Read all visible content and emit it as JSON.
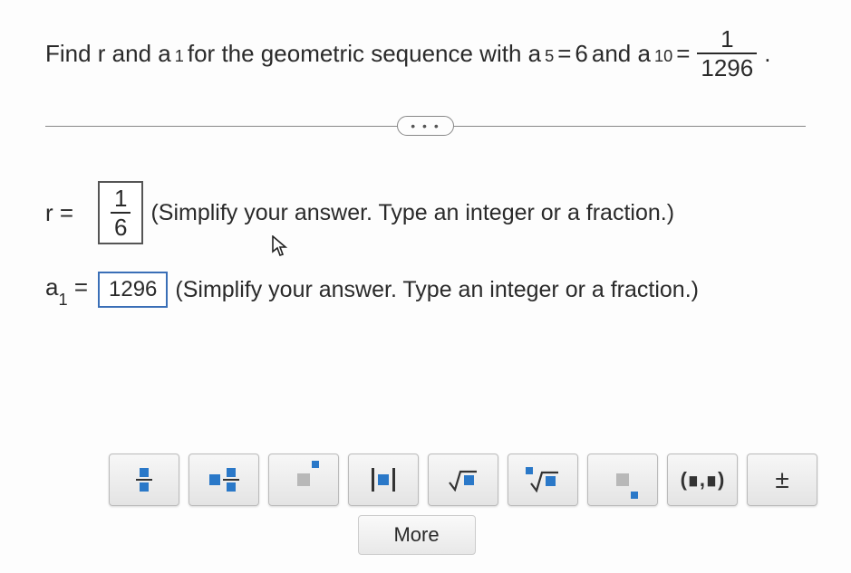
{
  "question": {
    "prefix": "Find r and a",
    "sub1": "1",
    "mid1": " for the geometric sequence with a",
    "sub5": "5",
    "eq1": " = ",
    "a5_value": "6",
    "and": " and a",
    "sub10": "10",
    "eq2": " = ",
    "a10_frac": {
      "num": "1",
      "den": "1296"
    },
    "period": "."
  },
  "divider": {
    "dots": "• • •"
  },
  "answers": {
    "r": {
      "label": "r =",
      "value": {
        "num": "1",
        "den": "6"
      },
      "hint": "(Simplify your answer. Type an integer or a fraction.)"
    },
    "a1": {
      "label_pre": "a",
      "label_sub": "1",
      "label_post": " =",
      "value": "1296",
      "hint": "(Simplify your answer. Type an integer or a fraction.)"
    }
  },
  "palette": {
    "buttons": [
      {
        "name": "fraction",
        "label": "fraction"
      },
      {
        "name": "mixed-number",
        "label": "mixed number"
      },
      {
        "name": "exponent",
        "label": "exponent"
      },
      {
        "name": "absolute-value",
        "label": "absolute value"
      },
      {
        "name": "square-root",
        "label": "square root"
      },
      {
        "name": "nth-root",
        "label": "nth root"
      },
      {
        "name": "subscript",
        "label": "subscript"
      },
      {
        "name": "ordered-pair",
        "label": "(∎,∎)"
      },
      {
        "name": "plus-minus",
        "label": "±"
      }
    ],
    "more": "More"
  }
}
